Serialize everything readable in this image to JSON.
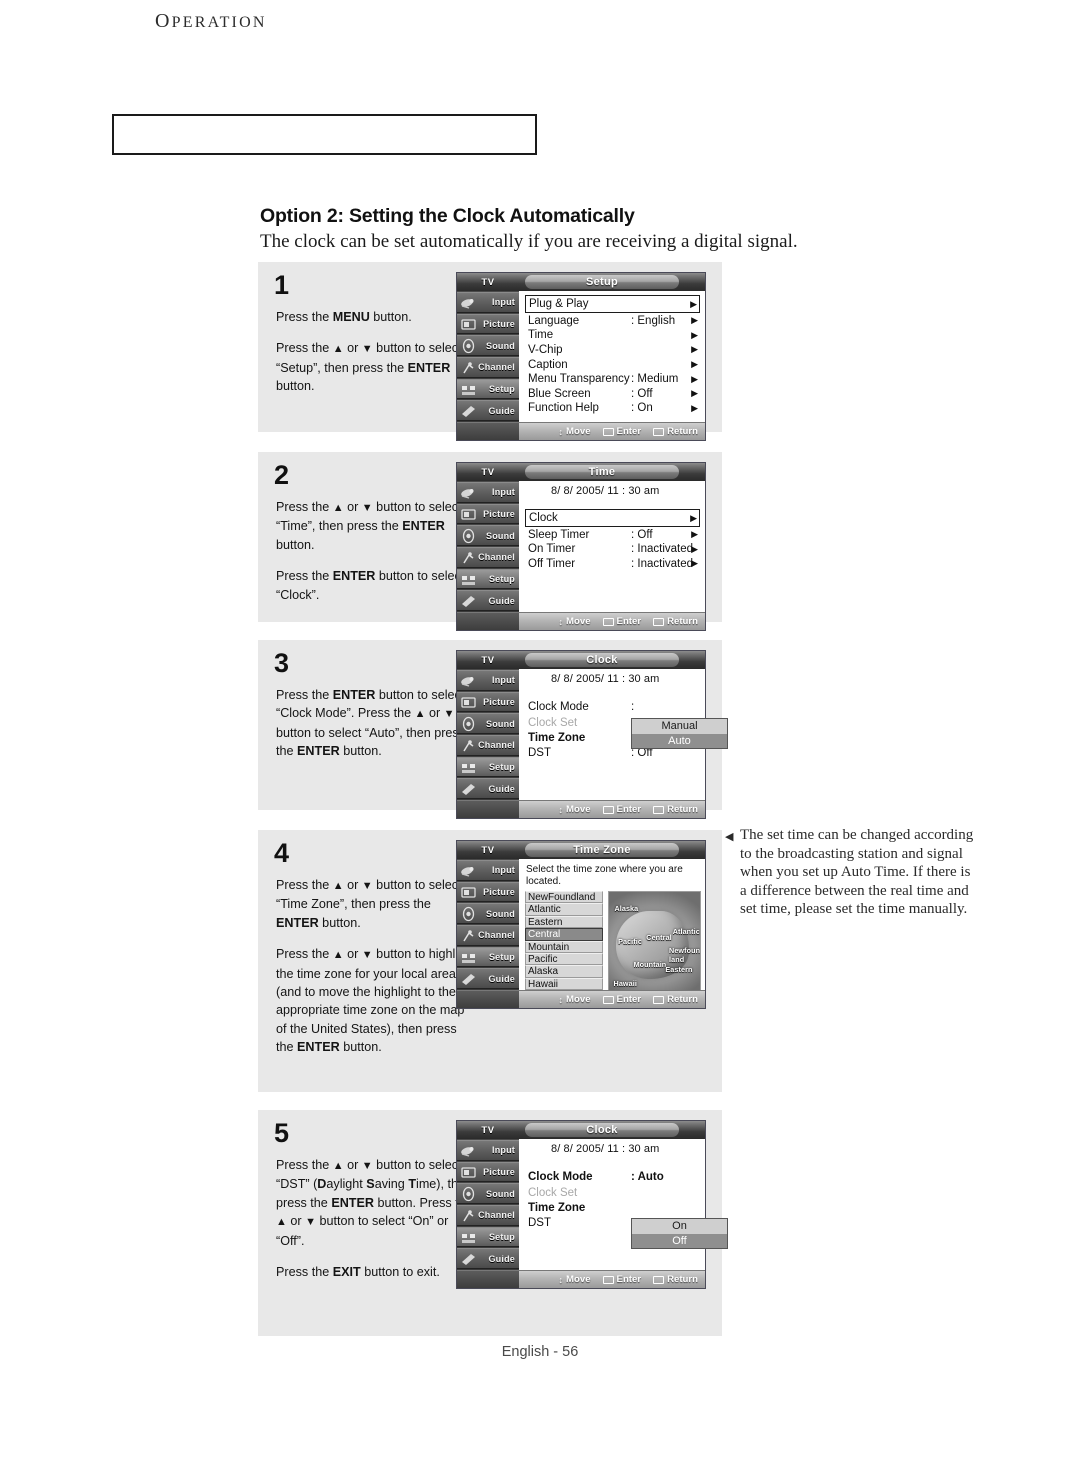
{
  "header": {
    "section": "Operation"
  },
  "heading": {
    "title": "Option 2: Setting the Clock Automatically",
    "subtitle": "The clock can be set automatically if you are receiving a digital signal."
  },
  "osd_common": {
    "tv_label": "TV",
    "sidebar": [
      {
        "label": "Input",
        "icon": "input-icon"
      },
      {
        "label": "Picture",
        "icon": "picture-icon"
      },
      {
        "label": "Sound",
        "icon": "sound-icon"
      },
      {
        "label": "Channel",
        "icon": "channel-icon"
      },
      {
        "label": "Setup",
        "icon": "setup-icon"
      },
      {
        "label": "Guide",
        "icon": "guide-icon"
      }
    ],
    "footer": {
      "move": "Move",
      "enter": "Enter",
      "return": "Return"
    },
    "datetime": "8/ 8/ 2005/ 11 : 30 am"
  },
  "steps": [
    {
      "number": "1",
      "paragraphs": [
        "Press the MENU button.",
        "Press the ▲ or ▼ button to select “Setup”, then press the ENTER button."
      ],
      "osd_title": "Setup",
      "menu": [
        {
          "label": "Plug & Play",
          "value": "",
          "arrow": "▶",
          "boxed": true
        },
        {
          "label": "Language",
          "value": ": English",
          "arrow": "▶"
        },
        {
          "label": "Time",
          "value": "",
          "arrow": "▶"
        },
        {
          "label": "V-Chip",
          "value": "",
          "arrow": "▶"
        },
        {
          "label": "Caption",
          "value": "",
          "arrow": "▶"
        },
        {
          "label": "Menu Transparency",
          "value": ": Medium",
          "arrow": "▶"
        },
        {
          "label": "Blue Screen",
          "value": ": Off",
          "arrow": "▶"
        },
        {
          "label": "Function Help",
          "value": ": On",
          "arrow": "▶"
        }
      ]
    },
    {
      "number": "2",
      "paragraphs": [
        "Press the ▲ or ▼ button to select “Time”, then press the ENTER button.",
        "Press the ENTER button to select “Clock”."
      ],
      "osd_title": "Time",
      "menu": [
        {
          "label": "Clock",
          "value": "",
          "arrow": "▶",
          "boxed": true
        },
        {
          "label": "Sleep Timer",
          "value": ": Off",
          "arrow": "▶"
        },
        {
          "label": "On Timer",
          "value": ": Inactivated",
          "arrow": "▶"
        },
        {
          "label": "Off Timer",
          "value": ": Inactivated",
          "arrow": "▶"
        }
      ]
    },
    {
      "number": "3",
      "paragraphs": [
        "Press the ENTER button to select “Clock Mode”. Press the ▲ or ▼ button to select “Auto”, then press the ENTER button."
      ],
      "osd_title": "Clock",
      "menu": [
        {
          "label": "Clock Mode",
          "value": ":",
          "dim": false
        },
        {
          "label": "Clock Set",
          "value": "",
          "dim": true
        },
        {
          "label": "Time Zone",
          "value": "",
          "bold": true
        },
        {
          "label": "DST",
          "value": ": Off"
        }
      ],
      "dropdown": {
        "options": [
          "Manual",
          "Auto"
        ],
        "selected": "Auto"
      }
    },
    {
      "number": "4",
      "paragraphs": [
        "Press the ▲ or ▼ button to select “Time Zone”, then press the ENTER button.",
        "Press the ▲ or ▼ button to highlight the time zone for your local area (and to move the highlight to the appropriate time zone on the map of the United States), then press the ENTER button."
      ],
      "osd_title": "Time Zone",
      "tz_note": "Select the time zone where you are located.",
      "tz_list": [
        "NewFoundland",
        "Atlantic",
        "Eastern",
        "Central",
        "Mountain",
        "Pacific",
        "Alaska",
        "Hawaii"
      ],
      "tz_selected": "Central",
      "map_labels": [
        "Alaska",
        "Pacific",
        "Central",
        "Atlantic",
        "Newfound-land",
        "Mountain",
        "Eastern",
        "Hawaii"
      ]
    },
    {
      "number": "5",
      "paragraphs": [
        "Press the ▲ or ▼ button to select “DST” (Daylight Saving Time), then press the ENTER button. Press the ▲ or ▼ button to select “On” or “Off”.",
        "Press the EXIT button to exit."
      ],
      "osd_title": "Clock",
      "menu": [
        {
          "label": "Clock Mode",
          "value": ": Auto",
          "bold": true
        },
        {
          "label": "Clock Set",
          "value": "",
          "dim": true
        },
        {
          "label": "Time Zone",
          "value": "",
          "bold": true
        },
        {
          "label": "DST",
          "value": ":"
        }
      ],
      "dropdown": {
        "options": [
          "On",
          "Off"
        ],
        "selected": "Off"
      }
    }
  ],
  "note": "The set time can be changed according to the  broadcasting station and signal when you set up Auto Time. If there is a difference between the real time and set time, please set the time manually.",
  "footer_text": "English - 56"
}
